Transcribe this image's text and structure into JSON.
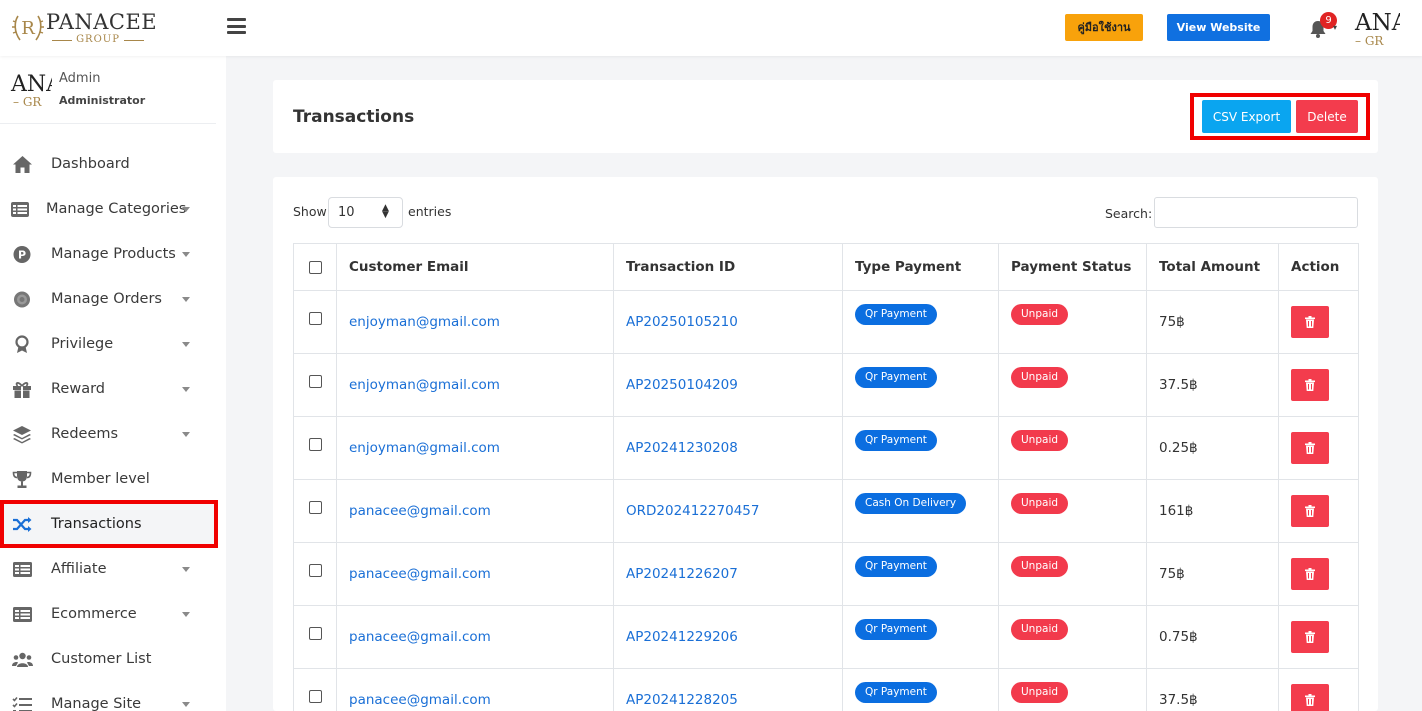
{
  "logo": {
    "brand": "PANACEE",
    "group": "GROUP"
  },
  "header": {
    "manual_label": "คู่มือใช้งาน",
    "view_website_label": "View Website",
    "notification_count": "9",
    "avatar_text": "ANA",
    "avatar_sub": "GR"
  },
  "profile": {
    "name": "Admin",
    "role": "Administrator",
    "avatar_text": "ANA",
    "avatar_sub": "GR"
  },
  "nav": [
    {
      "label": "Dashboard",
      "icon": "home-icon",
      "caret": false
    },
    {
      "label": "Manage Categories",
      "icon": "list-icon",
      "caret": true
    },
    {
      "label": "Manage Products",
      "icon": "product-p-icon",
      "caret": true
    },
    {
      "label": "Manage Orders",
      "icon": "gear-badge-icon",
      "caret": true
    },
    {
      "label": "Privilege",
      "icon": "award-icon",
      "caret": true
    },
    {
      "label": "Reward",
      "icon": "gift-icon",
      "caret": true
    },
    {
      "label": "Redeems",
      "icon": "layers-icon",
      "caret": true
    },
    {
      "label": "Member level",
      "icon": "trophy-icon",
      "caret": false
    },
    {
      "label": "Transactions",
      "icon": "shuffle-icon",
      "caret": false,
      "active": true
    },
    {
      "label": "Affiliate",
      "icon": "table-icon",
      "caret": true
    },
    {
      "label": "Ecommerce",
      "icon": "table-icon",
      "caret": true
    },
    {
      "label": "Customer List",
      "icon": "users-icon",
      "caret": false
    },
    {
      "label": "Manage Site",
      "icon": "tasks-icon",
      "caret": true
    }
  ],
  "page": {
    "title": "Transactions",
    "csv_export_label": "CSV Export",
    "delete_label": "Delete"
  },
  "table_controls": {
    "show_label": "Show",
    "entries_value": "10",
    "entries_label": "entries",
    "search_label": "Search:",
    "search_value": ""
  },
  "table": {
    "columns": [
      "Customer Email",
      "Transaction ID",
      "Type Payment",
      "Payment Status",
      "Total Amount",
      "Action"
    ],
    "rows": [
      {
        "email": "enjoyman@gmail.com",
        "id": "AP20250105210",
        "type": "Qr Payment",
        "status": "Unpaid",
        "amount": "75฿"
      },
      {
        "email": "enjoyman@gmail.com",
        "id": "AP20250104209",
        "type": "Qr Payment",
        "status": "Unpaid",
        "amount": "37.5฿"
      },
      {
        "email": "enjoyman@gmail.com",
        "id": "AP20241230208",
        "type": "Qr Payment",
        "status": "Unpaid",
        "amount": "0.25฿"
      },
      {
        "email": "panacee@gmail.com",
        "id": "ORD202412270457",
        "type": "Cash On Delivery",
        "status": "Unpaid",
        "amount": "161฿"
      },
      {
        "email": "panacee@gmail.com",
        "id": "AP20241226207",
        "type": "Qr Payment",
        "status": "Unpaid",
        "amount": "75฿"
      },
      {
        "email": "panacee@gmail.com",
        "id": "AP20241229206",
        "type": "Qr Payment",
        "status": "Unpaid",
        "amount": "0.75฿"
      },
      {
        "email": "panacee@gmail.com",
        "id": "AP20241228205",
        "type": "Qr Payment",
        "status": "Unpaid",
        "amount": "37.5฿"
      }
    ]
  },
  "colors": {
    "accent_blue": "#1070e0",
    "csv_blue": "#0aa5f0",
    "danger": "#f33c4d",
    "warning": "#f8a20b",
    "highlight": "#f00000"
  }
}
